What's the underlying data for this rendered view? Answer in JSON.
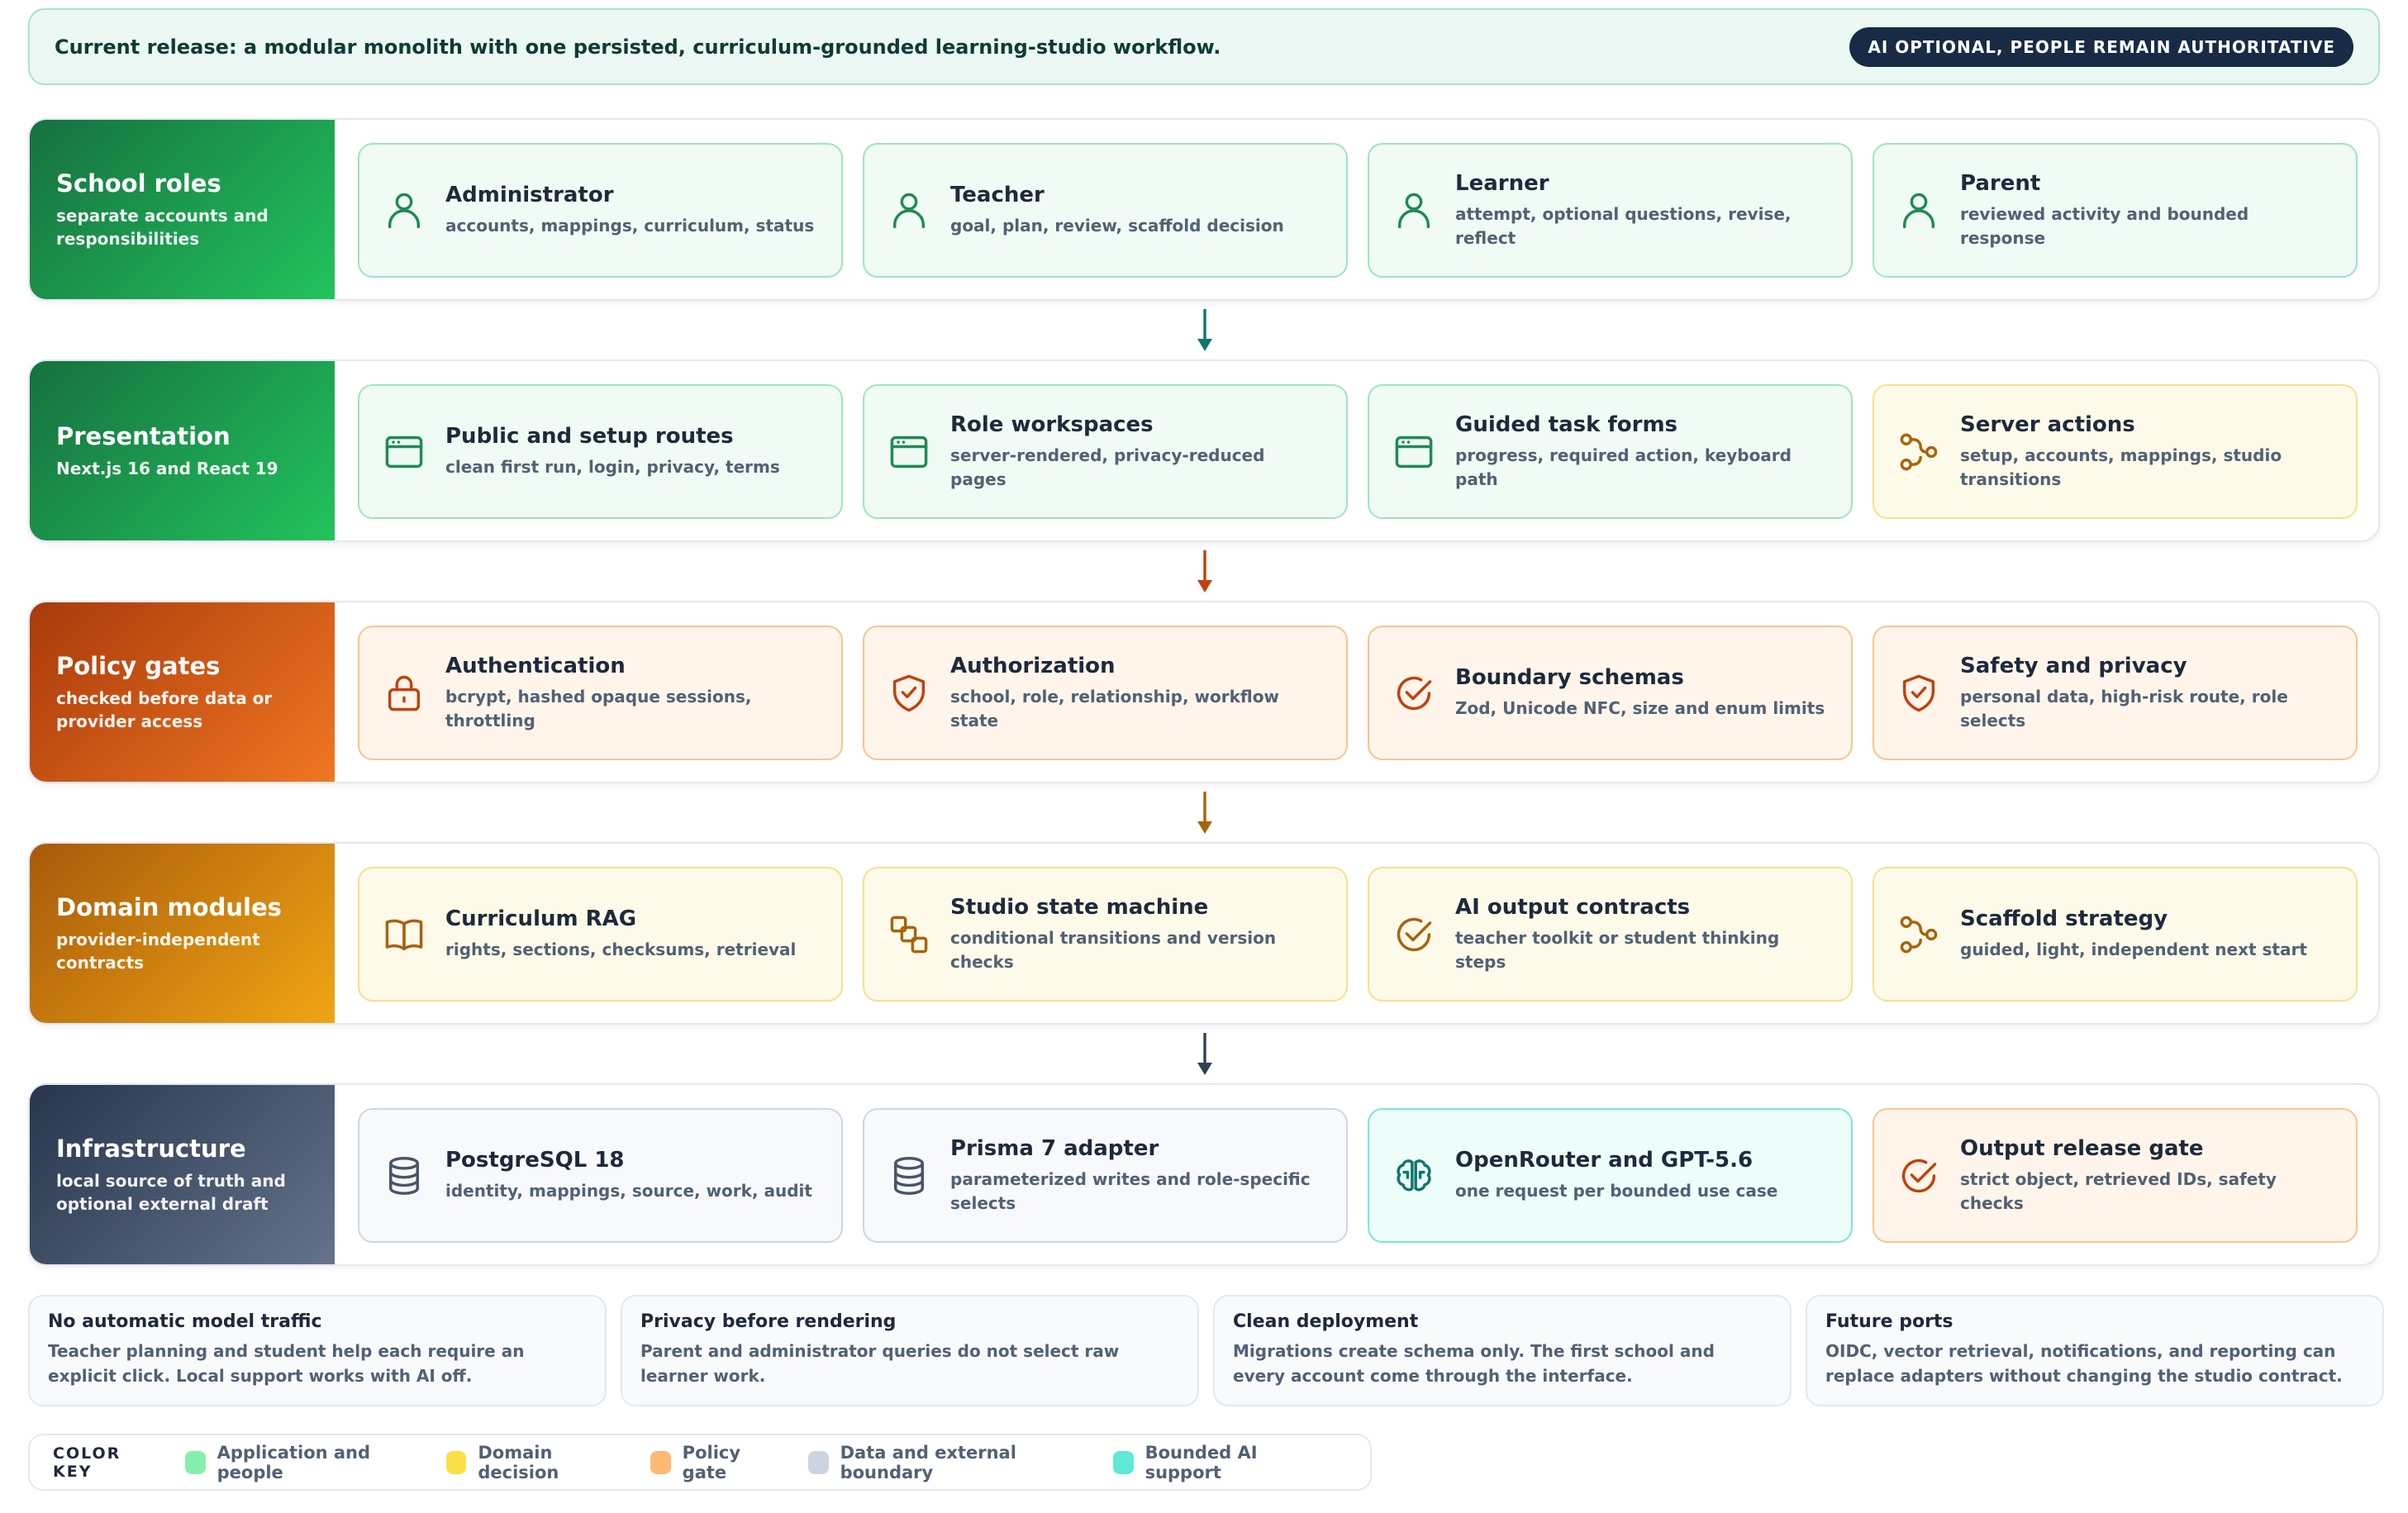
{
  "banner": {
    "text": "Current release: a modular monolith with one persisted, curriculum-grounded learning-studio workflow.",
    "badge": "AI OPTIONAL, PEOPLE REMAIN AUTHORITATIVE"
  },
  "colors": {
    "green": "#1a7f49",
    "orange": "#ea580c",
    "amber": "#e29a12",
    "slate": "#3c4a63",
    "teal": "#2cc9c0"
  },
  "layers": [
    {
      "title": "School roles",
      "subtitle": "separate accounts and responsibilities",
      "cards": [
        {
          "icon": "person-icon",
          "title": "Administrator",
          "desc": "accounts, mappings, curriculum, status"
        },
        {
          "icon": "person-icon",
          "title": "Teacher",
          "desc": "goal, plan, review, scaffold decision"
        },
        {
          "icon": "person-icon",
          "title": "Learner",
          "desc": "attempt, optional questions, revise, reflect"
        },
        {
          "icon": "person-icon",
          "title": "Parent",
          "desc": "reviewed activity and bounded response"
        }
      ]
    },
    {
      "title": "Presentation",
      "subtitle": "Next.js 16 and React 19",
      "cards": [
        {
          "icon": "browser-window-icon",
          "title": "Public and setup routes",
          "desc": "clean first run, login, privacy, terms"
        },
        {
          "icon": "browser-window-icon",
          "title": "Role workspaces",
          "desc": "server-rendered, privacy-reduced pages"
        },
        {
          "icon": "browser-window-icon",
          "title": "Guided task forms",
          "desc": "progress, required action, keyboard path"
        },
        {
          "icon": "branch-flow-icon",
          "title": "Server actions",
          "desc": "setup, accounts, mappings, studio transitions"
        }
      ]
    },
    {
      "title": "Policy gates",
      "subtitle": "checked before data or provider access",
      "cards": [
        {
          "icon": "lock-icon",
          "title": "Authentication",
          "desc": "bcrypt, hashed opaque sessions, throttling"
        },
        {
          "icon": "shield-check-icon",
          "title": "Authorization",
          "desc": "school, role, relationship, workflow state"
        },
        {
          "icon": "check-circle-icon",
          "title": "Boundary schemas",
          "desc": "Zod, Unicode NFC, size and enum limits"
        },
        {
          "icon": "shield-check-icon",
          "title": "Safety and privacy",
          "desc": "personal data, high-risk route, role selects"
        }
      ]
    },
    {
      "title": "Domain modules",
      "subtitle": "provider-independent contracts",
      "cards": [
        {
          "icon": "book-icon",
          "title": "Curriculum RAG",
          "desc": "rights, sections, checksums, retrieval"
        },
        {
          "icon": "state-machine-icon",
          "title": "Studio state machine",
          "desc": "conditional transitions and version checks"
        },
        {
          "icon": "check-circle-icon",
          "title": "AI output contracts",
          "desc": "teacher toolkit or student thinking steps"
        },
        {
          "icon": "branch-flow-icon",
          "title": "Scaffold strategy",
          "desc": "guided, light, independent next start"
        }
      ]
    },
    {
      "title": "Infrastructure",
      "subtitle": "local source of truth and optional external draft",
      "cards": [
        {
          "icon": "database-icon",
          "title": "PostgreSQL 18",
          "desc": "identity, mappings, source, work, audit"
        },
        {
          "icon": "database-icon",
          "title": "Prisma 7 adapter",
          "desc": "parameterized writes and role-specific selects"
        },
        {
          "icon": "brain-icon",
          "title": "OpenRouter and GPT-5.6",
          "desc": "one request per bounded use case"
        },
        {
          "icon": "check-circle-icon",
          "title": "Output release gate",
          "desc": "strict object, retrieved IDs, safety checks"
        }
      ]
    }
  ],
  "notes": [
    {
      "title": "No automatic model traffic",
      "body": "Teacher planning and student help each require an explicit click. Local support works with AI off."
    },
    {
      "title": "Privacy before rendering",
      "body": "Parent and administrator queries do not select raw learner work."
    },
    {
      "title": "Clean deployment",
      "body": "Migrations create schema only. The first school and every account come through the interface."
    },
    {
      "title": "Future ports",
      "body": "OIDC, vector retrieval, notifications, and reporting can replace adapters without changing the studio contract."
    }
  ],
  "color_key": {
    "title": "COLOR KEY",
    "items": [
      {
        "label": "Application and people",
        "color": "#86efac"
      },
      {
        "label": "Domain decision",
        "color": "#fde047"
      },
      {
        "label": "Policy gate",
        "color": "#fdba74"
      },
      {
        "label": "Data and external boundary",
        "color": "#cbd5e1"
      },
      {
        "label": "Bounded AI support",
        "color": "#5eead4"
      }
    ]
  }
}
